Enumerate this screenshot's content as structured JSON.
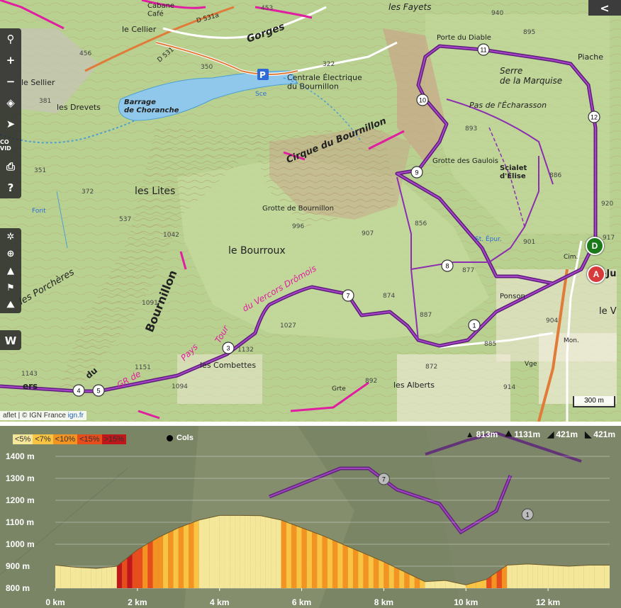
{
  "map": {
    "top_right_label": "<",
    "toolbar_left": [
      {
        "name": "search-icon",
        "glyph": "⚲"
      },
      {
        "name": "zoom-in-button",
        "glyph": "+"
      },
      {
        "name": "zoom-out-button",
        "glyph": "−"
      },
      {
        "name": "layers-icon",
        "glyph": "◈"
      },
      {
        "name": "locate-icon",
        "glyph": "➤"
      },
      {
        "name": "covid-label",
        "glyph": "CO VID"
      },
      {
        "name": "print-icon",
        "glyph": "⎙"
      },
      {
        "name": "help-icon",
        "glyph": "?"
      }
    ],
    "toolbar_left2": [
      {
        "name": "settings-icon",
        "glyph": "✲"
      },
      {
        "name": "globe-icon",
        "glyph": "⊕"
      },
      {
        "name": "mountain-icon",
        "glyph": "▲"
      },
      {
        "name": "hiker-icon",
        "glyph": "⚑"
      },
      {
        "name": "peak-icon",
        "glyph": "⛰"
      }
    ],
    "toolbar_w_label": "W",
    "attribution": {
      "text": "aflet | © IGN France ",
      "link": "ign.fr"
    },
    "scale_label": "300 m",
    "marker_D": "D",
    "marker_A": "A",
    "labels": {
      "cabane_cafe": "Cabane\nCafé",
      "le_cellier": "le Cellier",
      "gorges": "Gorges",
      "les_fayets": "les Fayets",
      "d531a": "D 531a",
      "d531": "D 531",
      "le_sellier": "le Sellier",
      "les_drevets": "les Drevets",
      "barrage": "Barrage\nde Choranche",
      "centrale": "Centrale Électrique\ndu Bournillon",
      "sce": "Sce",
      "porte_du_diable": "Porte du Diable",
      "piache": "Piache",
      "serre": "Serre\nde la Marquise",
      "pas_echarasson": "Pas de l'Écharasson",
      "cirque_du_bournillon": "Cirque du Bournillon",
      "grotte_gaulois": "Grotte des Gaulois",
      "scialet": "Scialet\nd'Élise",
      "les_lites": "les Lites",
      "grotte_bournillon": "Grotte de Bournillon",
      "le_bourroux": "le Bourroux",
      "bournillon_vertical": "Bournillon",
      "les_porcheres": "les Porchères",
      "vercors_dromois": "du Vercors Drômois",
      "pays": "Pays",
      "tour": "Tour",
      "gr_de": "GR de",
      "les_combettes": "les Combettes",
      "ponson": "Ponson",
      "les_alberts": "les Alberts",
      "grte": "Grte",
      "font": "Font",
      "st_epur": "St. Épur.",
      "cim": "Cim.",
      "vge": "Vge",
      "mon": "Mon.",
      "le_v": "le V",
      "ju": "-Ju",
      "du": "du",
      "ers": "ers",
      "elev": [
        "453",
        "456",
        "350",
        "322",
        "381",
        "351",
        "372",
        "537",
        "1042",
        "1091",
        "996",
        "907",
        "856",
        "893",
        "895",
        "940",
        "886",
        "920",
        "917",
        "901",
        "877",
        "874",
        "887",
        "885",
        "904",
        "914",
        "872",
        "892",
        "1027",
        "1094",
        "1151",
        "1132",
        "1143"
      ]
    },
    "waypoints": [
      "1",
      "3",
      "4",
      "5",
      "7",
      "8",
      "9",
      "10",
      "11",
      "12"
    ]
  },
  "profile": {
    "legend": [
      {
        "label": "<5%",
        "color": "#f5e79a"
      },
      {
        "label": "<7%",
        "color": "#f9c443"
      },
      {
        "label": "<10%",
        "color": "#f39322"
      },
      {
        "label": "<15%",
        "color": "#e74c1c"
      },
      {
        "label": ">15%",
        "color": "#c0171a"
      }
    ],
    "cols_label": "Cols",
    "stats": [
      {
        "icon": "min-altitude-icon",
        "value": "813m"
      },
      {
        "icon": "max-altitude-icon",
        "value": "1131m"
      },
      {
        "icon": "ascent-icon",
        "value": "421m"
      },
      {
        "icon": "descent-icon",
        "value": "421m"
      }
    ]
  },
  "chart_data": {
    "type": "area",
    "title": "",
    "xlabel": "",
    "ylabel": "",
    "x_unit": "km",
    "y_unit": "m",
    "xlim": [
      0,
      13.5
    ],
    "ylim": [
      800,
      1400
    ],
    "x_ticks": [
      "0 km",
      "2 km",
      "4 km",
      "6 km",
      "8 km",
      "10 km",
      "12 km"
    ],
    "y_ticks": [
      "800 m",
      "900 m",
      "1000 m",
      "1100 m",
      "1200 m",
      "1300 m",
      "1400 m"
    ],
    "x": [
      0,
      0.5,
      1.0,
      1.5,
      2.0,
      2.5,
      3.0,
      3.5,
      4.0,
      4.5,
      5.0,
      5.5,
      6.0,
      6.5,
      7.0,
      7.5,
      8.0,
      8.5,
      9.0,
      9.5,
      10.0,
      10.5,
      11.0,
      11.5,
      12.0,
      12.5,
      13.0,
      13.5
    ],
    "y": [
      905,
      895,
      890,
      900,
      975,
      1030,
      1075,
      1110,
      1131,
      1131,
      1130,
      1110,
      1075,
      1040,
      1000,
      960,
      920,
      875,
      830,
      835,
      815,
      840,
      905,
      910,
      905,
      900,
      905,
      905
    ],
    "markers": [
      {
        "label": "7",
        "x": 8.0
      },
      {
        "label": "1",
        "x": 11.5
      }
    ]
  }
}
